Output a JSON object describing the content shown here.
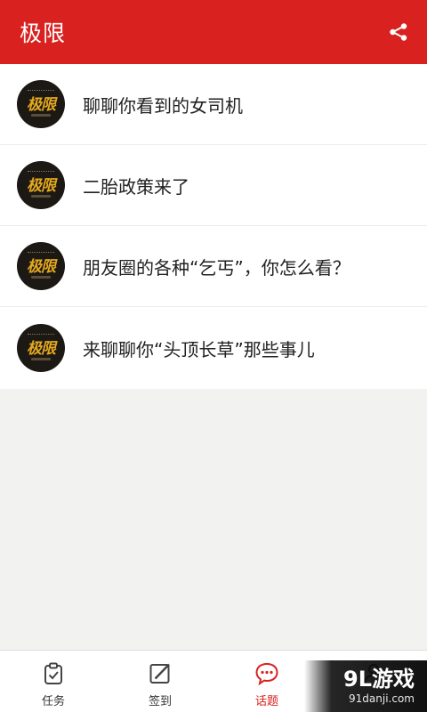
{
  "header": {
    "title": "极限",
    "share_icon": "share-icon"
  },
  "topics": [
    {
      "label": "聊聊你看到的女司机",
      "avatar_text": "极限"
    },
    {
      "label": "二胎政策来了",
      "avatar_text": "极限"
    },
    {
      "label": "朋友圈的各种“乞丐”，你怎么看？",
      "avatar_text": "极限"
    },
    {
      "label": "来聊聊你“头顶长草”那些事儿",
      "avatar_text": "极限"
    }
  ],
  "tabs": [
    {
      "label": "任务",
      "icon": "clipboard-check-icon"
    },
    {
      "label": "签到",
      "icon": "edit-icon"
    },
    {
      "label": "话题",
      "icon": "chat-bubble-icon"
    },
    {
      "label": "",
      "icon": "user-icon"
    }
  ],
  "active_tab": "话题",
  "colors": {
    "brand_red": "#d9221f",
    "avatar_bg": "#1c1814",
    "avatar_text": "#e2a81e"
  },
  "watermark": {
    "main": "9L游戏",
    "url": "91danji.com"
  }
}
